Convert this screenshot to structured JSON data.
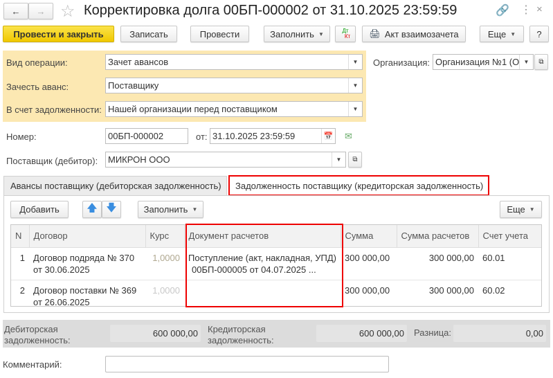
{
  "title": "Корректировка долга 00БП-000002 от 31.10.2025 23:59:59",
  "toolbar": {
    "post_close": "Провести и закрыть",
    "save": "Записать",
    "post": "Провести",
    "fill": "Заполнить",
    "dtkt_dt": "Дт",
    "dtkt_kt": "Кт",
    "act": "Акт взаимозачета",
    "more": "Еще",
    "help": "?"
  },
  "form": {
    "op_label": "Вид операции:",
    "op_value": "Зачет авансов",
    "offset_label": "Зачесть аванс:",
    "offset_value": "Поставщику",
    "debt_label": "В счет задолженности:",
    "debt_value": "Нашей организации перед поставщиком",
    "org_label": "Организация:",
    "org_value": "Организация №1 (О(",
    "number_label": "Номер:",
    "number_value": "00БП-000002",
    "date_label": "от:",
    "date_value": "31.10.2025 23:59:59",
    "supplier_label": "Поставщик (дебитор):",
    "supplier_value": "МИКРОН ООО"
  },
  "tabs": [
    "Авансы поставщику (дебиторская задолженность)",
    "Задолженность поставщику (кредиторская задолженность)"
  ],
  "tab_toolbar": {
    "add": "Добавить",
    "fill": "Заполнить",
    "more": "Еще"
  },
  "table": {
    "headers": [
      "N",
      "Договор",
      "Курс",
      "Документ расчетов",
      "Сумма",
      "Сумма расчетов",
      "Счет учета"
    ],
    "rows": [
      {
        "n": "1",
        "contract1": "Договор подряда № 370",
        "contract2": "от 30.06.2025",
        "rate": "1,0000",
        "doc1": "Поступление (акт, накладная, УПД)",
        "doc2": "00БП-000005 от 04.07.2025 ...",
        "sum": "300 000,00",
        "sum_calc": "300 000,00",
        "account": "60.01"
      },
      {
        "n": "2",
        "contract1": "Договор поставки № 369",
        "contract2": "от 26.06.2025",
        "rate": "1,0000",
        "doc1": "",
        "doc2": "",
        "sum": "300 000,00",
        "sum_calc": "300 000,00",
        "account": "60.02"
      }
    ]
  },
  "totals": {
    "debit_label1": "Дебиторская",
    "debit_label2": "задолженность:",
    "debit_value": "600 000,00",
    "credit_label1": "Кредиторская",
    "credit_label2": "задолженность:",
    "credit_value": "600 000,00",
    "diff_label": "Разница:",
    "diff_value": "0,00"
  },
  "comment": {
    "label": "Комментарий:",
    "value": ""
  }
}
